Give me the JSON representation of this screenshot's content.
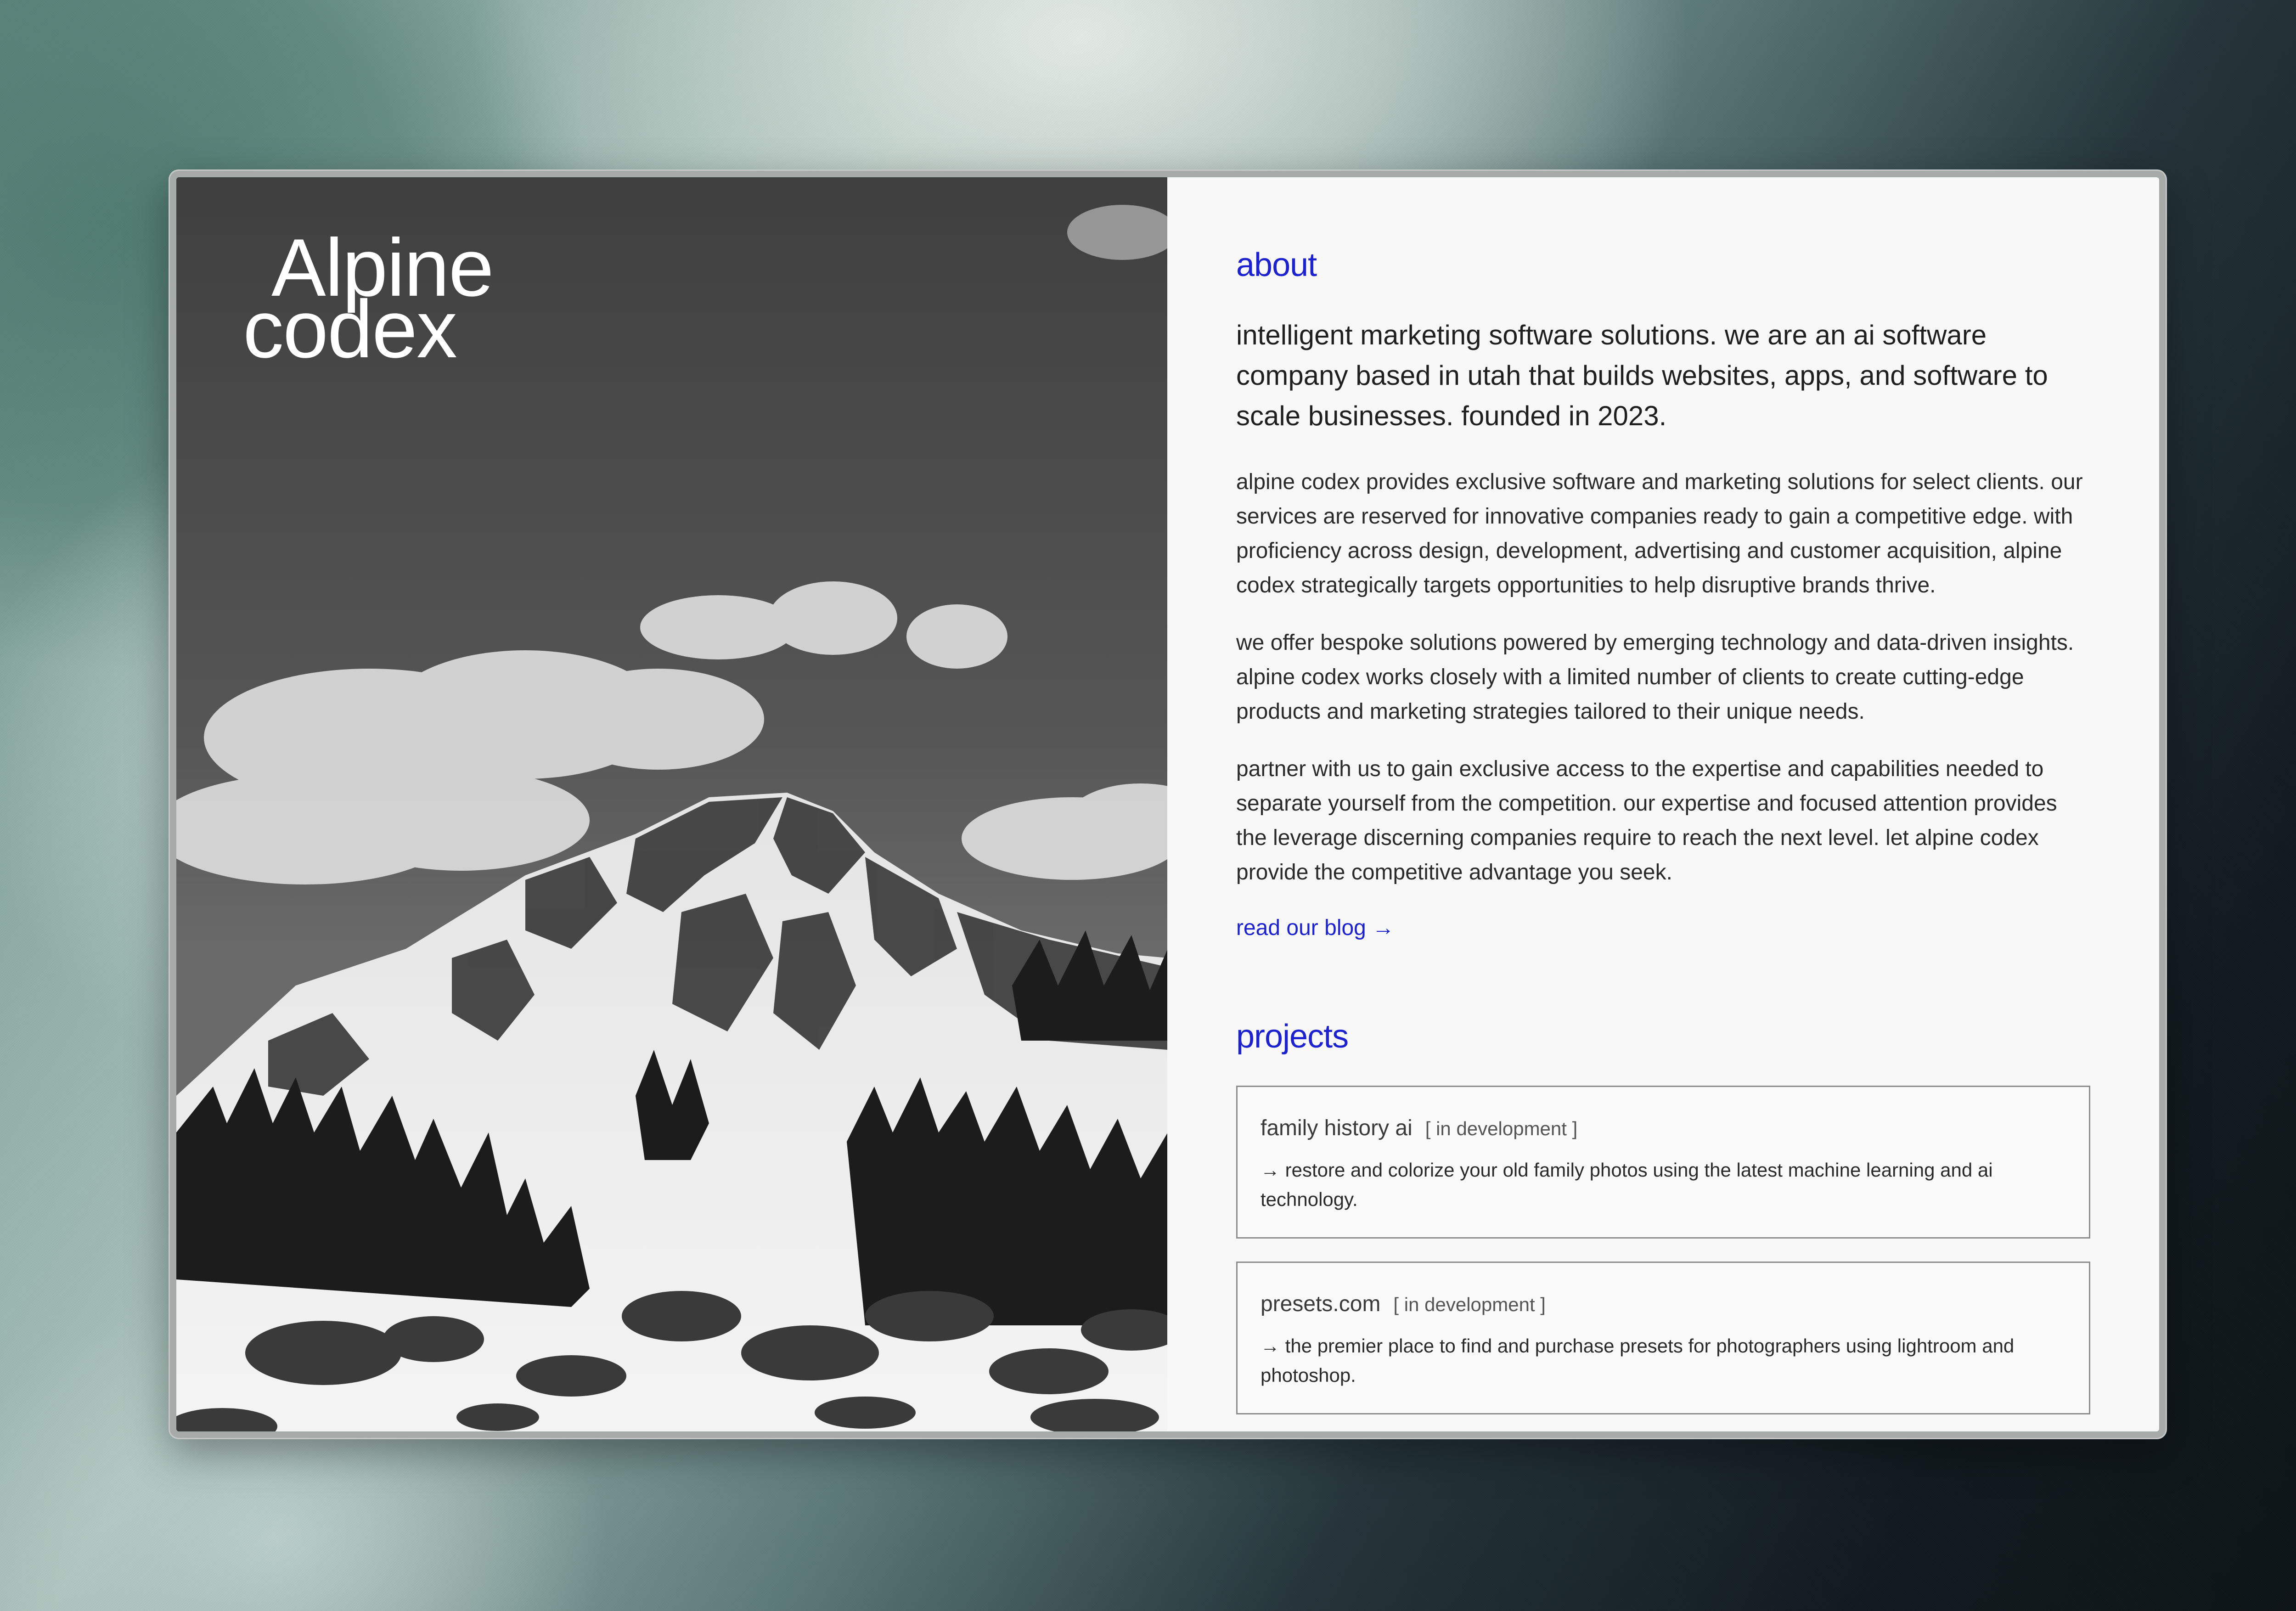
{
  "brand": {
    "line1": "Alpine",
    "line2": "codex"
  },
  "about": {
    "title": "about",
    "lead": "intelligent marketing software solutions. we are an ai software company based in utah that builds websites, apps, and software to scale businesses. founded in 2023.",
    "paragraphs": [
      "alpine codex provides exclusive software and marketing solutions for select clients. our services are reserved for innovative companies ready to gain a competitive edge. with proficiency across design, development, advertising and customer acquisition, alpine codex strategically targets opportunities to help disruptive brands thrive.",
      "we offer bespoke solutions powered by emerging technology and data-driven insights. alpine codex works closely with a limited number of clients to create cutting-edge products and marketing strategies tailored to their unique needs.",
      "partner with us to gain exclusive access to the expertise and capabilities needed to separate yourself from the competition. our expertise and focused attention provides the leverage discerning companies require to reach the next level. let alpine codex provide the competitive advantage you seek."
    ],
    "blog_link": "read our blog →"
  },
  "projects": {
    "title": "projects",
    "items": [
      {
        "name": "family history ai",
        "status": "[ in development ]",
        "description": "→ restore and colorize your old family photos using the latest machine learning and ai technology."
      },
      {
        "name": "presets.com",
        "status": "[ in development ]",
        "description": "→ the premier place to find and purchase presets for photographers using lightroom and photoshop."
      }
    ]
  },
  "colors": {
    "accent": "#1d22d1",
    "panel_background": "#f8f8f8",
    "text": "#1f1f1f"
  },
  "icons": {
    "arrow": "arrow-right-icon"
  }
}
